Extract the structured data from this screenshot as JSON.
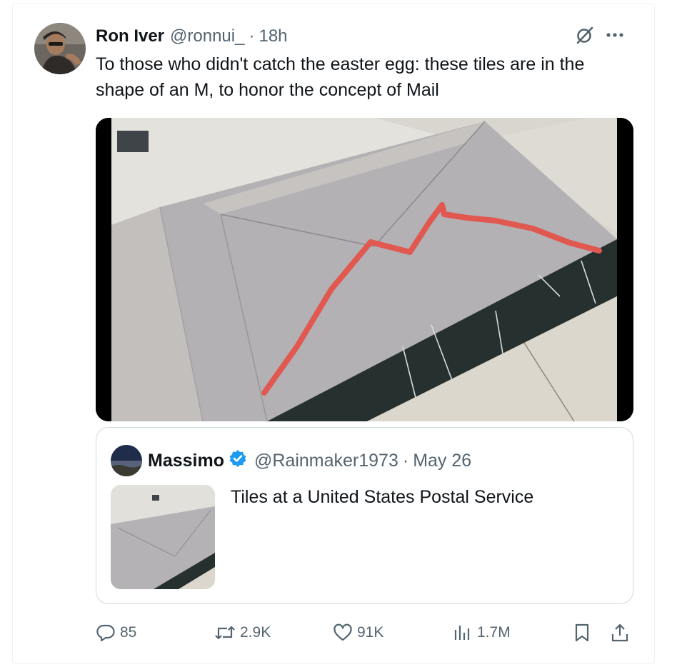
{
  "tweet": {
    "author_name": "Ron Iver",
    "handle": "@ronnui_",
    "separator": "·",
    "time": "18h",
    "text": "To those who didn't catch the easter egg: these tiles are in the shape of an M, to honor the concept of Mail"
  },
  "quote": {
    "author_name": "Massimo",
    "handle": "@Rainmaker1973",
    "separator": "·",
    "date": "May 26",
    "text": "Tiles at a United States Postal Service"
  },
  "actions": {
    "replies": "85",
    "reposts": "2.9K",
    "likes": "91K",
    "views": "1.7M"
  },
  "icons": [
    "grok-icon",
    "more-icon",
    "verified-badge-icon",
    "reply-icon",
    "repost-icon",
    "like-icon",
    "views-icon",
    "bookmark-icon",
    "share-icon"
  ],
  "colors": {
    "verified": "#1d9bf0",
    "annotation_line": "#e0584f",
    "muted_text": "#536471"
  }
}
